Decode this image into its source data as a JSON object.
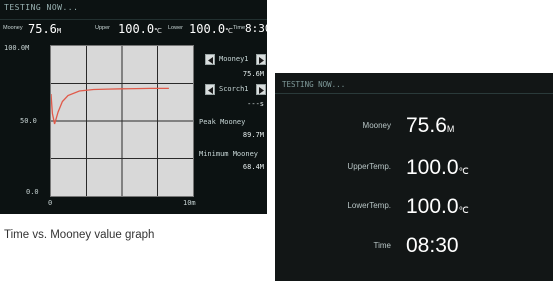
{
  "panel1": {
    "status": "TESTING NOW...",
    "mooney_label": "Mooney",
    "mooney_value": "75.6",
    "mooney_unit": "M",
    "upper_label": "Upper",
    "upper_value": "100.0",
    "upper_unit": "℃",
    "lower_label": "Lower",
    "lower_value": "100.0",
    "lower_unit": "℃",
    "time_label": "Time",
    "time_value": "8:30",
    "y_top": "100.0M",
    "y_mid": "50.0",
    "y_bot": "0.0",
    "x_start": "0",
    "x_end": "10m",
    "side": {
      "mooney_btn_label": "Mooney1",
      "mooney_btn_value": "75.6M",
      "scorch_btn_label": "Scorch1",
      "scorch_btn_value": "---s",
      "peak_label": "Peak Mooney",
      "peak_value": "89.7M",
      "min_label": "Minimum Mooney",
      "min_value": "68.4M"
    }
  },
  "caption": "Time vs. Mooney value graph",
  "panel2": {
    "status": "TESTING NOW...",
    "rows": [
      {
        "label": "Mooney",
        "value": "75.6",
        "unit": "M"
      },
      {
        "label": "UpperTemp.",
        "value": "100.0",
        "unit": "℃"
      },
      {
        "label": "LowerTemp.",
        "value": "100.0",
        "unit": "℃"
      },
      {
        "label": "Time",
        "value": "08:30",
        "unit": ""
      }
    ]
  },
  "chart_data": {
    "type": "line",
    "xlabel": "",
    "ylabel": "",
    "xlim": [
      0,
      10
    ],
    "ylim": [
      0,
      100
    ],
    "grid": true,
    "series": [
      {
        "color": "#e05a4a",
        "x": [
          0,
          0.1,
          0.25,
          0.5,
          0.8,
          1.2,
          2,
          3,
          4,
          5,
          6,
          7,
          8.3
        ],
        "y": [
          68,
          55,
          48,
          56,
          63,
          67,
          70,
          71,
          71.3,
          71.5,
          71.6,
          71.7,
          71.7
        ]
      }
    ]
  },
  "colors": {
    "panel_bg": "#0c1212",
    "graph_bg": "#d8d8d8",
    "curve": "#e05a4a",
    "accent_text": "#c8d7d7"
  }
}
